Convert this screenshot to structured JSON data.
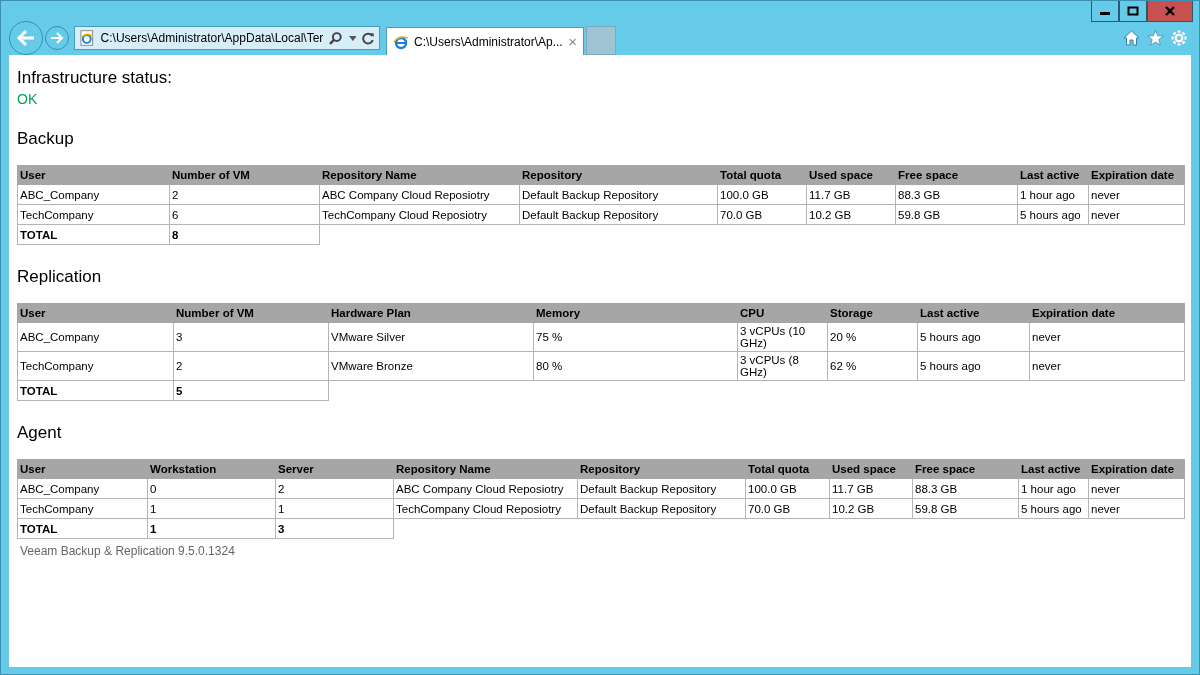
{
  "browser": {
    "address": "C:\\Users\\Administrator\\AppData\\Local\\Ter",
    "tab_title": "C:\\Users\\Administrator\\Ap...",
    "tab_close": "×"
  },
  "status": {
    "label": "Infrastructure status:",
    "value": "OK"
  },
  "sections": [
    {
      "title": "Backup",
      "columns": [
        "User",
        "Number of VM",
        "Repository Name",
        "Repository",
        "Total quota",
        "Used space",
        "Free space",
        "Last active",
        "Expiration date"
      ],
      "rows": [
        [
          "ABC_Company",
          "2",
          "ABC Company Cloud Reposiotry",
          "Default Backup Repository",
          "100.0 GB",
          "11.7 GB",
          "88.3 GB",
          "1 hour ago",
          "never"
        ],
        [
          "TechCompany",
          "6",
          "TechCompany Cloud Reposiotry",
          "Default Backup Repository",
          "70.0 GB",
          "10.2 GB",
          "59.8 GB",
          "5 hours ago",
          "never"
        ]
      ],
      "total": [
        "TOTAL",
        "8"
      ]
    },
    {
      "title": "Replication",
      "columns": [
        "User",
        "Number of VM",
        "Hardware Plan",
        "Memory",
        "CPU",
        "Storage",
        "Last active",
        "Expiration date"
      ],
      "rows": [
        [
          "ABC_Company",
          "3",
          "VMware Silver",
          "75 %",
          "3 vCPUs (10 GHz)",
          "20 %",
          "5 hours ago",
          "never"
        ],
        [
          "TechCompany",
          "2",
          "VMware Bronze",
          "80 %",
          "3 vCPUs (8 GHz)",
          "62 %",
          "5 hours ago",
          "never"
        ]
      ],
      "total": [
        "TOTAL",
        "5"
      ]
    },
    {
      "title": "Agent",
      "columns": [
        "User",
        "Workstation",
        "Server",
        "Repository Name",
        "Repository",
        "Total quota",
        "Used space",
        "Free space",
        "Last active",
        "Expiration date"
      ],
      "rows": [
        [
          "ABC_Company",
          "0",
          "2",
          "ABC Company Cloud Reposiotry",
          "Default Backup Repository",
          "100.0 GB",
          "11.7 GB",
          "88.3 GB",
          "1 hour ago",
          "never"
        ],
        [
          "TechCompany",
          "1",
          "1",
          "TechCompany Cloud Reposiotry",
          "Default Backup Repository",
          "70.0 GB",
          "10.2 GB",
          "59.8 GB",
          "5 hours ago",
          "never"
        ]
      ],
      "total": [
        "TOTAL",
        "1",
        "3"
      ]
    }
  ],
  "footer": "Veeam Backup & Replication 9.5.0.1324"
}
